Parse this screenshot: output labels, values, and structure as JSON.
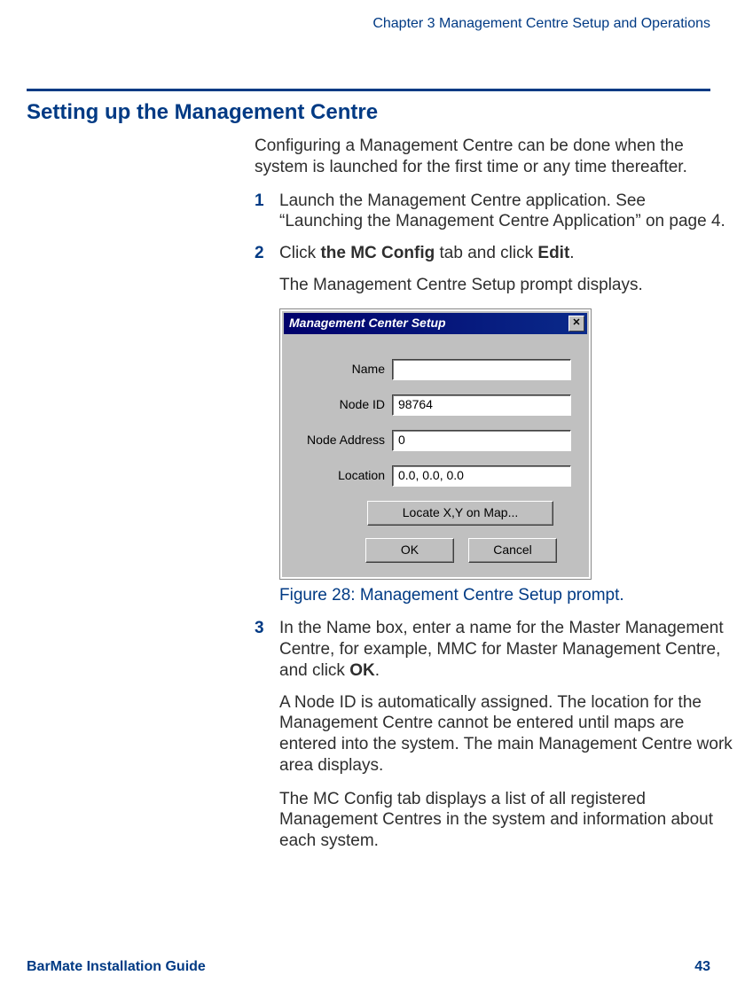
{
  "header": {
    "chapter": "Chapter 3 Management Centre Setup and Operations"
  },
  "section": {
    "title": "Setting up the Management Centre",
    "intro": "Configuring a Management Centre can be done when the system is launched for the first time or any time thereafter."
  },
  "steps": {
    "s1": {
      "num": "1",
      "text": "Launch the Management Centre application. See “Launching the Management Centre Application” on page 4."
    },
    "s2": {
      "num": "2",
      "pre": "Click ",
      "b1": "the MC Config",
      "mid": " tab and click ",
      "b2": "Edit",
      "post": ".",
      "after": "The Management Centre Setup prompt displays."
    },
    "s3": {
      "num": "3",
      "pre": "In the Name box, enter a name for the Master Management Centre, for example, MMC for Master Management Centre, and click ",
      "b1": "OK",
      "post": ".",
      "after1": "A Node ID is automatically assigned. The location for the Management Centre cannot be entered until maps are entered into the system. The main Management Centre work area displays.",
      "after2": "The MC Config tab displays a list of all registered Management Centres in the system and information about each system."
    }
  },
  "dialog": {
    "title": "Management Center Setup",
    "labels": {
      "name": "Name",
      "nodeid": "Node ID",
      "nodeaddr": "Node Address",
      "location": "Location"
    },
    "values": {
      "name": "",
      "nodeid": "98764",
      "nodeaddr": "0",
      "location": "0.0, 0.0, 0.0"
    },
    "buttons": {
      "locate": "Locate X,Y on Map...",
      "ok": "OK",
      "cancel": "Cancel"
    }
  },
  "figure": {
    "caption": "Figure 28: Management Centre Setup prompt."
  },
  "footer": {
    "left": "BarMate Installation Guide",
    "right": "43"
  }
}
